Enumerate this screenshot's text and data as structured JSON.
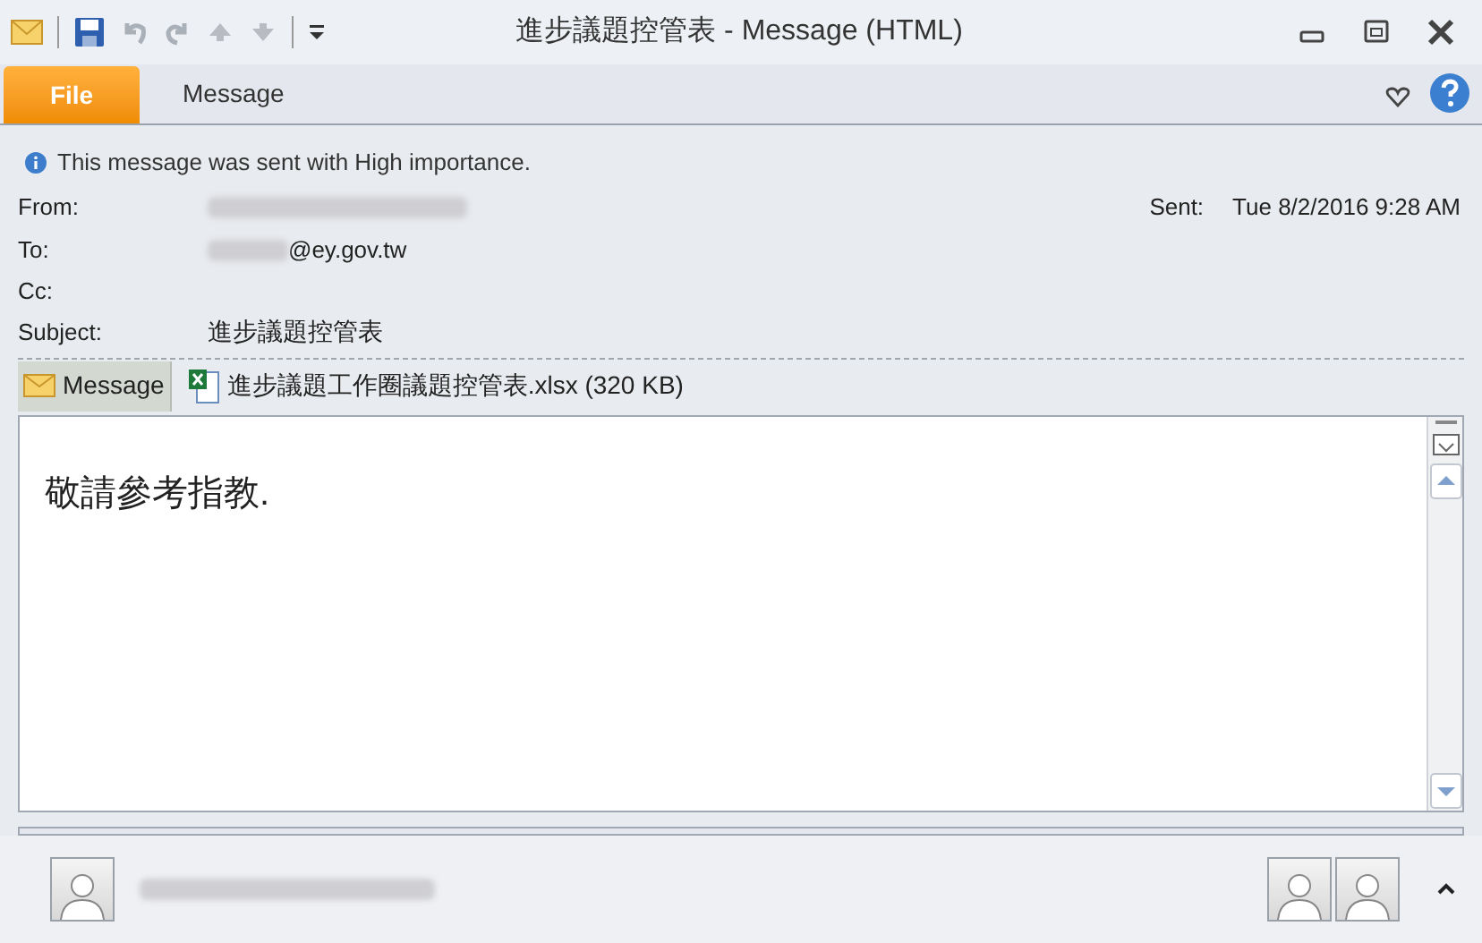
{
  "window": {
    "title": "進步議題控管表  -  Message (HTML)"
  },
  "ribbon": {
    "tabs": [
      {
        "label": "File",
        "kind": "file",
        "selected": false
      },
      {
        "label": "Message",
        "kind": "tab",
        "selected": true
      }
    ]
  },
  "info_bar": {
    "text": "This message was sent with High importance."
  },
  "header": {
    "from_label": "From:",
    "to_label": "To:",
    "to_value": "@ey.gov.tw",
    "cc_label": "Cc:",
    "subject_label": "Subject:",
    "subject": "進步議題控管表",
    "sent_label": "Sent:",
    "sent": "Tue 8/2/2016 9:28 AM"
  },
  "attachments": [
    {
      "kind": "message",
      "label": "Message",
      "selected": true
    },
    {
      "kind": "file",
      "label": "進步議題工作圈議題控管表.xlsx (320 KB)",
      "selected": false
    }
  ],
  "body": {
    "text": "敬請參考指教."
  }
}
